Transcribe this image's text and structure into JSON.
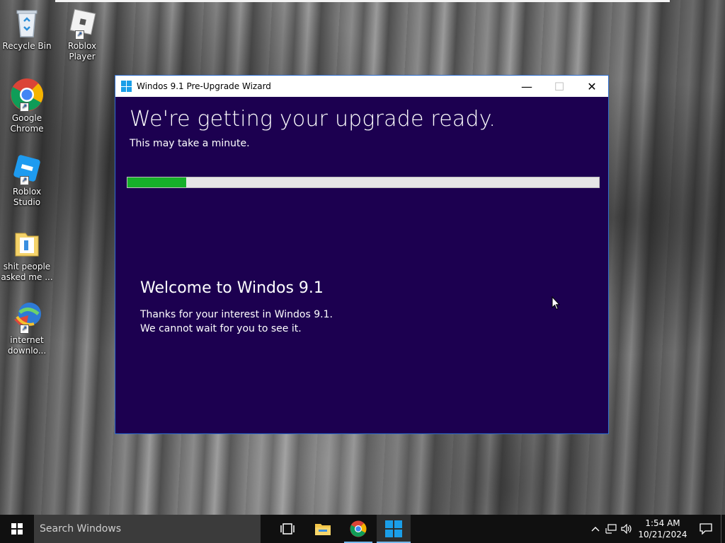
{
  "desktop": {
    "icons": [
      {
        "label": "Recycle Bin"
      },
      {
        "label": "Roblox Player"
      },
      {
        "label": "Google Chrome"
      },
      {
        "label": "Roblox Studio"
      },
      {
        "label": "shit people asked me ..."
      },
      {
        "label": "internet downlo..."
      }
    ]
  },
  "window": {
    "title": "Windos 9.1 Pre-Upgrade Wizard",
    "headline": "We're getting your upgrade ready.",
    "subhead": "This may take a minute.",
    "progress_fraction": 0.125,
    "welcome_title": "Welcome to Windos 9.1",
    "welcome_line1": "Thanks for your interest in Windos 9.1.",
    "welcome_line2": "We cannot wait for you to see it.",
    "buttons": {
      "minimize": "—",
      "maximize": "☐",
      "close": "✕"
    }
  },
  "taskbar": {
    "search_placeholder": "Search Windows",
    "time": "1:54 AM",
    "date": "10/21/2024"
  },
  "colors": {
    "window_bg": "#1c0050",
    "progress_fill": "#16b02a",
    "accent": "#1a9ee8"
  }
}
